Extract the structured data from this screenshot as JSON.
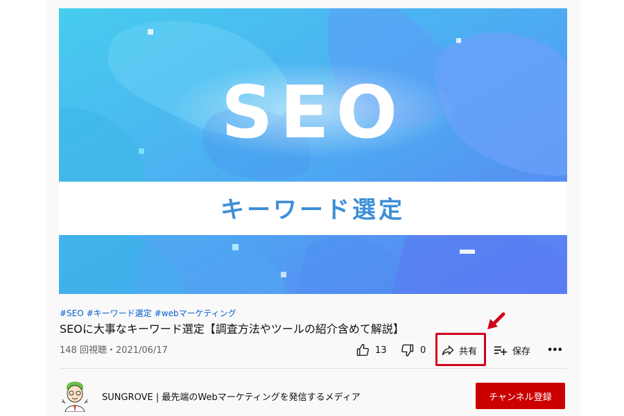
{
  "thumbnail": {
    "headline": "SEO",
    "subtitle": "キーワード選定"
  },
  "video": {
    "hashtags": [
      "#SEO",
      "#キーワード選定",
      "#webマーケティング"
    ],
    "title": "SEOに大事なキーワード選定【調査方法やツールの紹介含めて解説】",
    "meta": "148 回視聴・2021/06/17"
  },
  "actions": {
    "like_count": "13",
    "dislike_count": "0",
    "share_label": "共有",
    "save_label": "保存",
    "more_label": "•••"
  },
  "channel": {
    "name": "SUNGROVE | 最先端のWebマーケティングを発信するメディア",
    "subscribe_label": "チャンネル登録"
  },
  "colors": {
    "link": "#065fd4",
    "subscribe": "#cc0000",
    "highlight": "#d0021b",
    "thumb_gradient": [
      "#3fc6ea",
      "#5a86f5"
    ]
  }
}
